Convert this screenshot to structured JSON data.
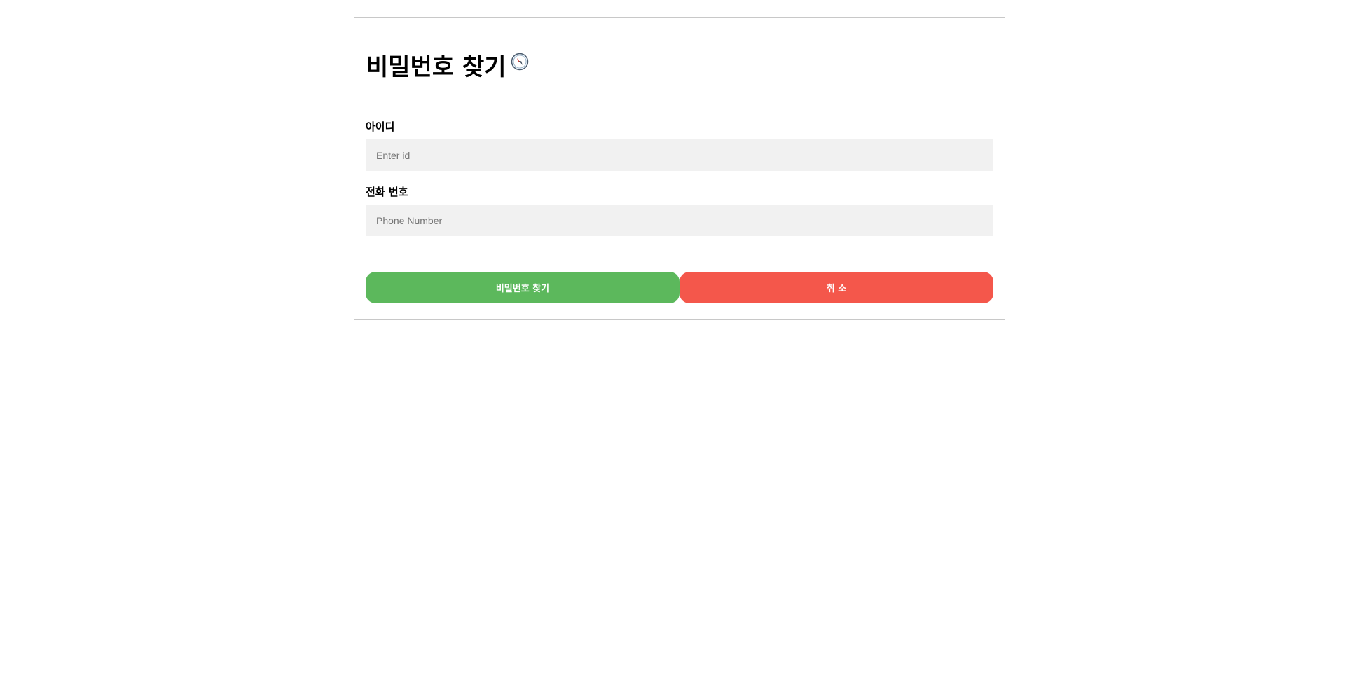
{
  "form": {
    "title": "비밀번호 찾기",
    "title_icon": "compass-icon",
    "fields": [
      {
        "label": "아이디",
        "value": "",
        "placeholder": "Enter id"
      },
      {
        "label": "전화 번호",
        "value": "",
        "placeholder": "Phone Number"
      }
    ],
    "buttons": {
      "submit_label": "비밀번호 찾기",
      "cancel_label": "취 소"
    }
  },
  "colors": {
    "submit_button": "#5cb85c",
    "cancel_button": "#f4574b",
    "input_background": "#f1f1f1",
    "border": "#c8c8c8"
  }
}
